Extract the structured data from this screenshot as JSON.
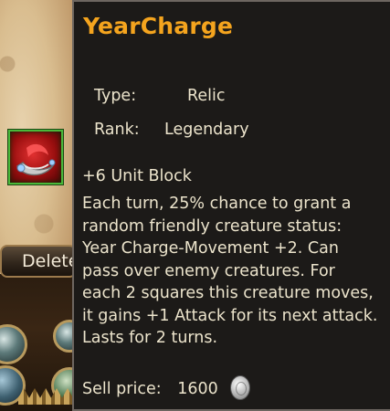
{
  "background": {
    "delete_button_label": "Delete"
  },
  "tooltip": {
    "title": "YearCharge",
    "type_label": "Type:",
    "type_value": "Relic",
    "rank_label": "Rank:",
    "rank_value": "Legendary",
    "stat": "+6 Unit Block",
    "description_lines": [
      "Each turn, 25% chance to grant a",
      "random friendly creature status:",
      "Year Charge-Movement +2. Can",
      "pass over enemy creatures. For",
      "each 2 squares this creature moves,",
      "it gains +1 Attack for its next attack.",
      "Lasts for 2 turns."
    ],
    "sell_label": "Sell price:",
    "sell_value": "1600",
    "currency_icon": "silver-coin-icon"
  },
  "colors": {
    "title": "#f4a41e",
    "text": "#ece4cc",
    "panel_bg": "#1c1a18",
    "slot_border": "#49b83a"
  }
}
